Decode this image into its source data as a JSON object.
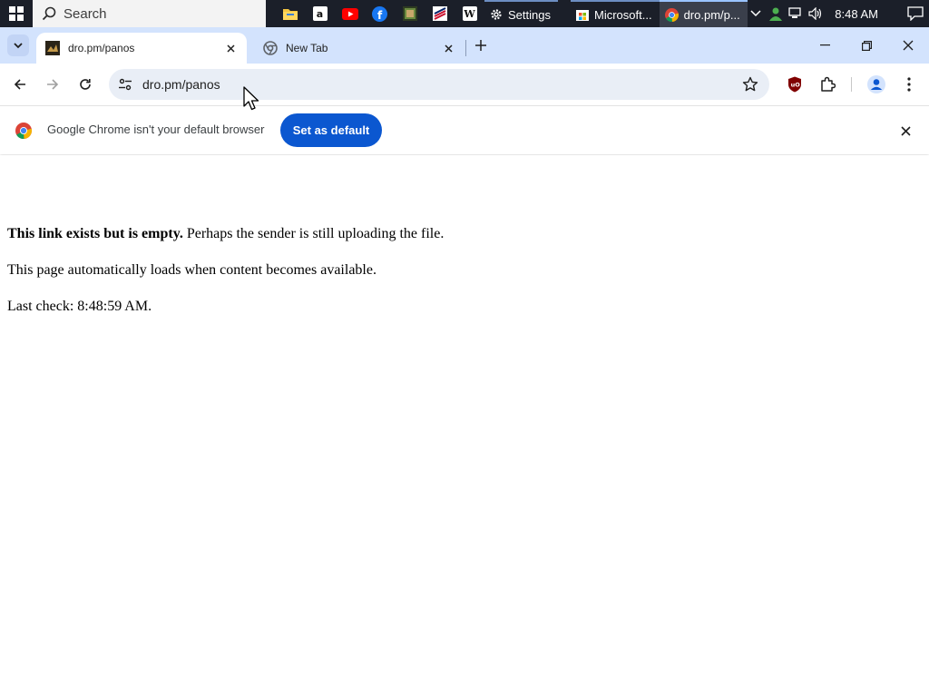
{
  "taskbar": {
    "search_placeholder": "Search",
    "apps": [
      {
        "name": "file-explorer",
        "color": "#f4c542"
      },
      {
        "name": "amazon",
        "color": "#ffffff"
      },
      {
        "name": "youtube",
        "color": "#ff0000"
      },
      {
        "name": "facebook",
        "color": "#1877f2"
      },
      {
        "name": "media",
        "color": "#5a7a3a"
      },
      {
        "name": "bank-of-america",
        "color": "#c8102e"
      },
      {
        "name": "wikipedia",
        "color": "#ffffff"
      }
    ],
    "settings_label": "Settings",
    "store_label": "Microsoft...",
    "chrome_label": "dro.pm/p...",
    "clock": "8:48 AM"
  },
  "tabs": [
    {
      "title": "dro.pm/panos",
      "active": true
    },
    {
      "title": "New Tab",
      "active": false
    }
  ],
  "toolbar": {
    "url": "dro.pm/panos"
  },
  "infobar": {
    "message": "Google Chrome isn't your default browser",
    "button_label": "Set as default"
  },
  "page": {
    "line1_bold": "This link exists but is empty.",
    "line1_rest": " Perhaps the sender is still uploading the file.",
    "line2": "This page automatically loads when content becomes available.",
    "line3": "Last check: 8:48:59 AM."
  },
  "colors": {
    "accent": "#0b57d0",
    "tabstrip": "#d3e3fd",
    "omnibox": "#e9eef6",
    "taskbar": "#1b1f29"
  }
}
